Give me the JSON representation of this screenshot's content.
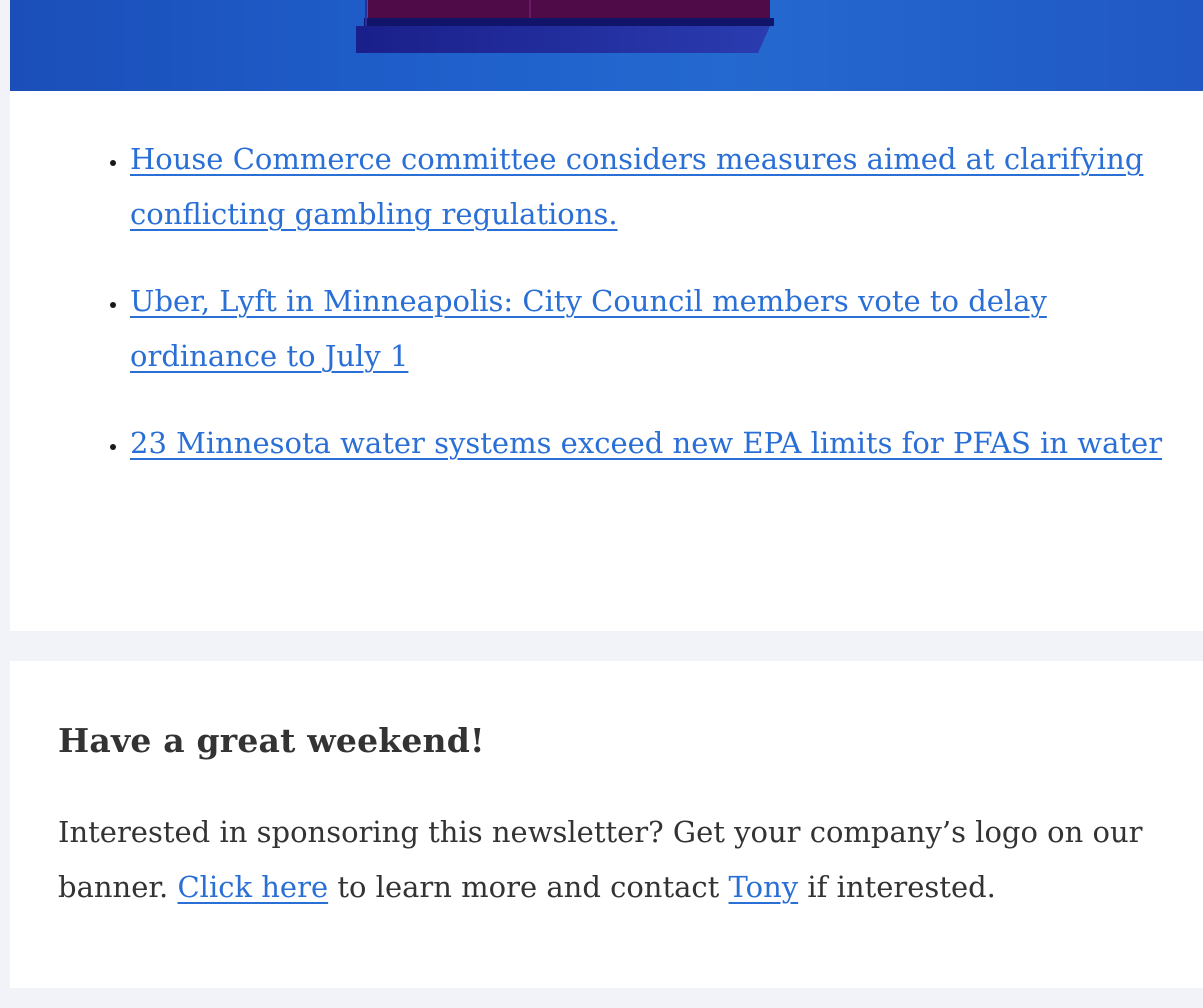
{
  "news": {
    "items": [
      {
        "text": "House Commerce committee considers measures aimed at clarifying conflicting gambling regulations."
      },
      {
        "text": "Uber, Lyft in Minneapolis: City Council members vote to delay ordinance to July 1"
      },
      {
        "text": "23 Minnesota water systems exceed new EPA limits for PFAS in water"
      }
    ]
  },
  "footer": {
    "heading": "Have a great weekend!",
    "sponsor_part1": "Interested in sponsoring this newsletter? Get your company’s logo on our banner.",
    "click_here": "Click here",
    "sponsor_part2": "to learn more and contact",
    "contact_name": "Tony",
    "sponsor_part3": "if interested."
  },
  "colors": {
    "link": "#2a6fd6",
    "hero_blue": "#1f5fcb",
    "hero_block": "#4f0a48",
    "page_bg": "#f2f3f8",
    "text": "#333333"
  }
}
